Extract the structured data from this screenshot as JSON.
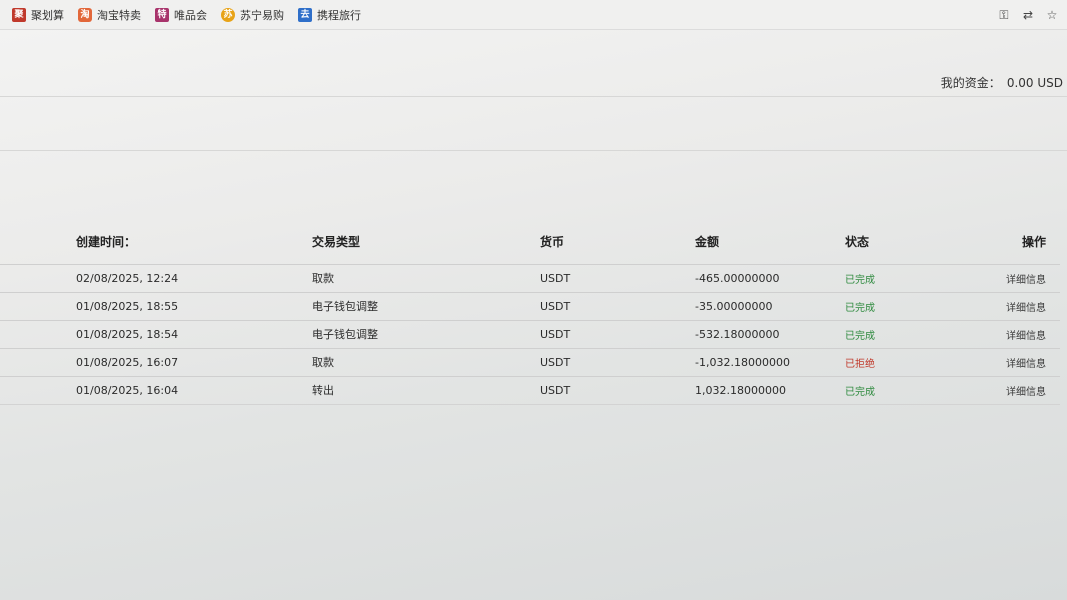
{
  "bookmarks": [
    {
      "label": "聚划算",
      "icon": "juhuasuan-icon",
      "glyph": "聚"
    },
    {
      "label": "淘宝特卖",
      "icon": "taobao-icon",
      "glyph": "淘"
    },
    {
      "label": "唯品会",
      "icon": "vip-icon",
      "glyph": "特"
    },
    {
      "label": "苏宁易购",
      "icon": "suning-icon",
      "glyph": "苏"
    },
    {
      "label": "携程旅行",
      "icon": "ctrip-icon",
      "glyph": "去"
    }
  ],
  "funds": {
    "label": "我的资金：",
    "amount": "0.00 USD"
  },
  "table": {
    "headers": {
      "time": "创建时间：",
      "type": "交易类型",
      "currency": "货币",
      "amount": "金额",
      "status": "状态",
      "action": "操作"
    },
    "rows": [
      {
        "time": "02/08/2025, 12:24",
        "type": "取款",
        "currency": "USDT",
        "amount": "-465.00000000",
        "status": "已完成",
        "status_kind": "done",
        "action": "详细信息"
      },
      {
        "time": "01/08/2025, 18:55",
        "type": "电子钱包调整",
        "currency": "USDT",
        "amount": "-35.00000000",
        "status": "已完成",
        "status_kind": "done",
        "action": "详细信息"
      },
      {
        "time": "01/08/2025, 18:54",
        "type": "电子钱包调整",
        "currency": "USDT",
        "amount": "-532.18000000",
        "status": "已完成",
        "status_kind": "done",
        "action": "详细信息"
      },
      {
        "time": "01/08/2025, 16:07",
        "type": "取款",
        "currency": "USDT",
        "amount": "-1,032.18000000",
        "status": "已拒绝",
        "status_kind": "rejected",
        "action": "详细信息"
      },
      {
        "time": "01/08/2025, 16:04",
        "type": "转出",
        "currency": "USDT",
        "amount": "1,032.18000000",
        "status": "已完成",
        "status_kind": "done",
        "action": "详细信息"
      }
    ]
  },
  "colors": {
    "done": "#2e8a3e",
    "rejected": "#c0392b"
  }
}
